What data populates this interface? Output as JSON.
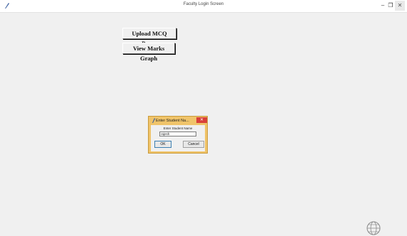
{
  "window": {
    "title": "Faculty Login Screen",
    "controls": {
      "minimize": "–",
      "maximize": "❐",
      "close": "✕"
    }
  },
  "main": {
    "upload_button": "Upload MCQ Paper",
    "graph_button": "View Marks Graph"
  },
  "dialog": {
    "title": "Enter Student Na...",
    "close_glyph": "✕",
    "prompt": "Enter Student Name",
    "input_value": "rajesh",
    "ok_label": "OK",
    "cancel_label": "Cancel"
  },
  "icons": {
    "app": "feather-icon",
    "dialog": "feather-icon",
    "corner": "globe-icon"
  },
  "colors": {
    "background": "#f0f0f0",
    "dialog_frame": "#f0c46a",
    "dialog_close": "#d9403a"
  }
}
